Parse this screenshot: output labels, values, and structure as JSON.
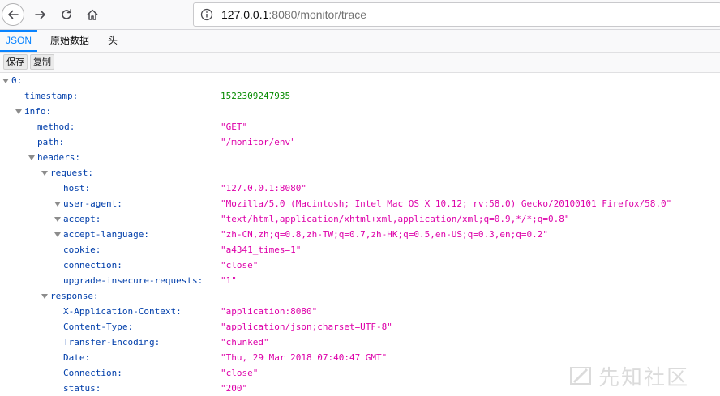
{
  "browser": {
    "url_host": "127.0.0.1",
    "url_rest": ":8080/monitor/trace"
  },
  "viewer": {
    "tabs": [
      "JSON",
      "原始数据",
      "头"
    ],
    "active_tab": "JSON",
    "toolbar": {
      "save_label": "保存",
      "copy_label": "复制"
    }
  },
  "tree": [
    {
      "depth": 0,
      "key": "0:",
      "expanded": true
    },
    {
      "depth": 1,
      "key": "timestamp:",
      "value": "1522309247935",
      "type": "num"
    },
    {
      "depth": 1,
      "key": "info:",
      "expanded": true
    },
    {
      "depth": 2,
      "key": "method:",
      "value": "\"GET\"",
      "type": "str"
    },
    {
      "depth": 2,
      "key": "path:",
      "value": "\"/monitor/env\"",
      "type": "str"
    },
    {
      "depth": 2,
      "key": "headers:",
      "expanded": true
    },
    {
      "depth": 3,
      "key": "request:",
      "expanded": true
    },
    {
      "depth": 4,
      "key": "host:",
      "value": "\"127.0.0.1:8080\"",
      "type": "str"
    },
    {
      "depth": 4,
      "key": "user-agent:",
      "value": "\"Mozilla/5.0 (Macintosh; Intel Mac OS X 10.12; rv:58.0) Gecko/20100101 Firefox/58.0\"",
      "type": "str",
      "expanded": true
    },
    {
      "depth": 4,
      "key": "accept:",
      "value": "\"text/html,application/xhtml+xml,application/xml;q=0.9,*/*;q=0.8\"",
      "type": "str",
      "expanded": true
    },
    {
      "depth": 4,
      "key": "accept-language:",
      "value": "\"zh-CN,zh;q=0.8,zh-TW;q=0.7,zh-HK;q=0.5,en-US;q=0.3,en;q=0.2\"",
      "type": "str",
      "expanded": true
    },
    {
      "depth": 4,
      "key": "cookie:",
      "value": "\"a4341_times=1\"",
      "type": "str"
    },
    {
      "depth": 4,
      "key": "connection:",
      "value": "\"close\"",
      "type": "str"
    },
    {
      "depth": 4,
      "key": "upgrade-insecure-requests:",
      "value": "\"1\"",
      "type": "str"
    },
    {
      "depth": 3,
      "key": "response:",
      "expanded": true
    },
    {
      "depth": 4,
      "key": "X-Application-Context:",
      "value": "\"application:8080\"",
      "type": "str"
    },
    {
      "depth": 4,
      "key": "Content-Type:",
      "value": "\"application/json;charset=UTF-8\"",
      "type": "str"
    },
    {
      "depth": 4,
      "key": "Transfer-Encoding:",
      "value": "\"chunked\"",
      "type": "str"
    },
    {
      "depth": 4,
      "key": "Date:",
      "value": "\"Thu, 29 Mar 2018 07:40:47 GMT\"",
      "type": "str"
    },
    {
      "depth": 4,
      "key": "Connection:",
      "value": "\"close\"",
      "type": "str"
    },
    {
      "depth": 4,
      "key": "status:",
      "value": "\"200\"",
      "type": "str"
    }
  ],
  "watermark": {
    "text": "先知社区"
  },
  "colors": {
    "key": "#003eaa",
    "string": "#dd00a9",
    "number": "#058b00",
    "accent": "#0a84ff"
  }
}
